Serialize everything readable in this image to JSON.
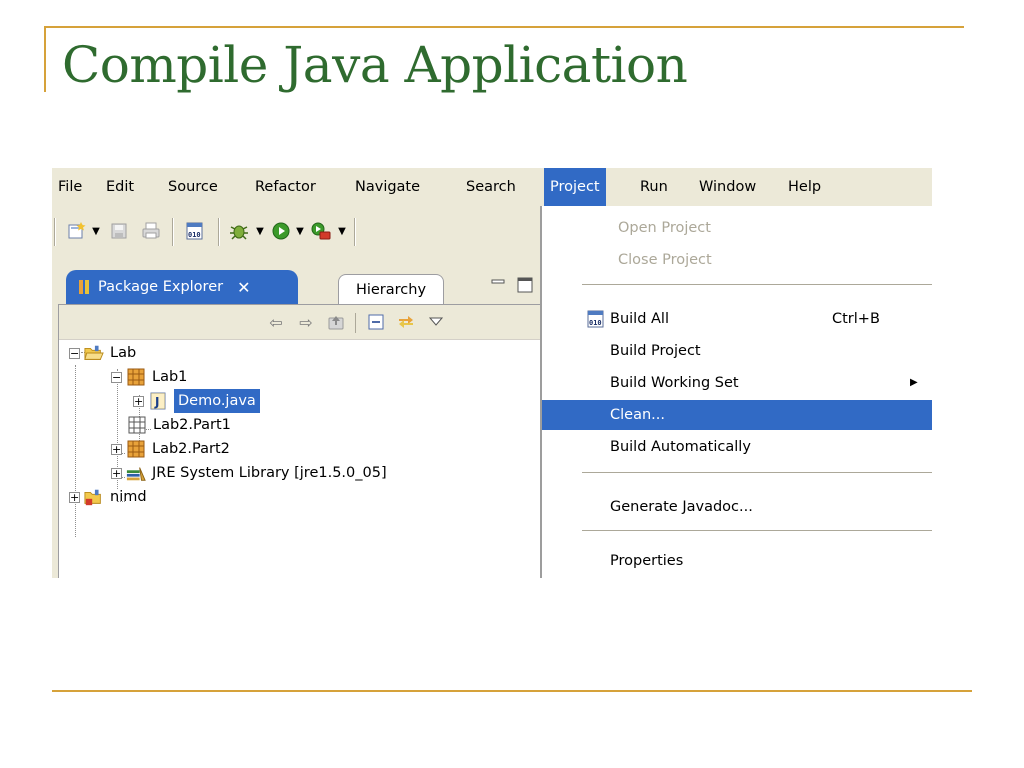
{
  "slide": {
    "title": "Compile Java Application"
  },
  "menubar": {
    "items": [
      "File",
      "Edit",
      "Source",
      "Refactor",
      "Navigate",
      "Search",
      "Project",
      "Run",
      "Window",
      "Help"
    ],
    "active": "Project"
  },
  "toolbar": {
    "icons": [
      "new-wizard-icon",
      "save-icon",
      "print-icon",
      "build-all-icon",
      "debug-icon",
      "run-icon",
      "external-tools-icon"
    ]
  },
  "explorer": {
    "tab_active": "Package Explorer",
    "tab_close_glyph": "✕",
    "tab_inactive": "Hierarchy",
    "tree": [
      {
        "label": "Lab",
        "type": "project",
        "expanded": true
      },
      {
        "label": "Lab1",
        "type": "package",
        "expanded": true
      },
      {
        "label": "Demo.java",
        "type": "java-file",
        "selected": true
      },
      {
        "label": "Lab2.Part1",
        "type": "package-empty"
      },
      {
        "label": "Lab2.Part2",
        "type": "package"
      },
      {
        "label": "JRE System Library [jre1.5.0_05]",
        "type": "library"
      },
      {
        "label": "nimd",
        "type": "project"
      }
    ]
  },
  "project_menu": {
    "open_project": "Open Project",
    "close_project": "Close Project",
    "build_all": "Build All",
    "build_all_shortcut": "Ctrl+B",
    "build_project": "Build Project",
    "build_working_set": "Build Working Set",
    "clean": "Clean...",
    "build_automatically": "Build Automatically",
    "generate_javadoc": "Generate Javadoc...",
    "properties": "Properties"
  },
  "colors": {
    "title_green": "#2F6B2F",
    "rule_gold": "#D6A23A",
    "selection_blue": "#316AC5",
    "chrome_beige": "#ECE9D8"
  }
}
